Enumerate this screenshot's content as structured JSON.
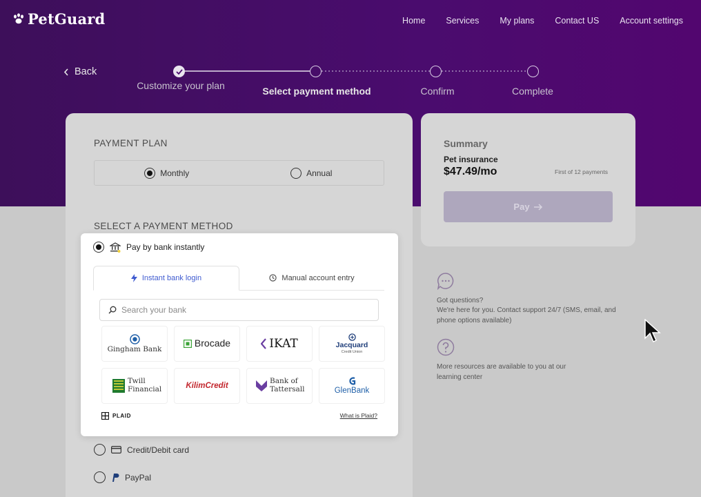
{
  "brand": {
    "name": "PetGuard"
  },
  "nav": [
    "Home",
    "Services",
    "My plans",
    "Contact US",
    "Account settings"
  ],
  "back_label": "Back",
  "steps": [
    {
      "label": "Customize your plan",
      "state": "done"
    },
    {
      "label": "Select payment method",
      "state": "active"
    },
    {
      "label": "Confirm",
      "state": "pending"
    },
    {
      "label": "Complete",
      "state": "pending"
    }
  ],
  "payment_plan": {
    "title": "PAYMENT PLAN",
    "options": [
      {
        "label": "Monthly",
        "selected": true
      },
      {
        "label": "Annual",
        "selected": false
      }
    ]
  },
  "payment_method": {
    "title": "SELECT A PAYMENT METHOD",
    "bank_option_label": "Pay by bank instantly",
    "tabs": [
      {
        "label": "Instant bank login",
        "icon": "bolt-icon",
        "active": true
      },
      {
        "label": "Manual account entry",
        "icon": "clock-icon",
        "active": false
      }
    ],
    "search_placeholder": "Search your bank",
    "banks": [
      {
        "name": "Gingham Bank",
        "icon": "gingham-logo-icon"
      },
      {
        "name": "Brocade",
        "icon": "brocade-logo-icon"
      },
      {
        "name": "IKAT",
        "icon": "ikat-logo-icon"
      },
      {
        "name": "Jacquard",
        "sub": "Credit Union",
        "icon": "jacquard-logo-icon"
      },
      {
        "name": "Twill Financial",
        "icon": "twill-logo-icon"
      },
      {
        "name": "KilimCredit",
        "icon": "kilim-logo-icon"
      },
      {
        "name": "Bank of Tattersall",
        "icon": "tattersall-logo-icon"
      },
      {
        "name": "GlenBank",
        "icon": "glenbank-logo-icon"
      }
    ],
    "plaid_label": "PLAID",
    "what_is_plaid": "What is Plaid?",
    "other_options": [
      {
        "label": "Credit/Debit card",
        "icon": "card-icon"
      },
      {
        "label": "PayPal",
        "icon": "paypal-icon"
      }
    ]
  },
  "summary": {
    "title": "Summary",
    "item": "Pet insurance",
    "price": "$47.49/mo",
    "note": "First of 12 payments",
    "pay_label": "Pay"
  },
  "help": {
    "questions_text": "Got questions?",
    "support_text": "We're here for you. Contact support 24/7 (SMS, email, and phone options available)",
    "resources_text": "More resources are available to you at our learning center"
  },
  "colors": {
    "hero": "#4a0c6e",
    "accent": "#3f5bd0",
    "overlay": "#c9c9c9"
  }
}
